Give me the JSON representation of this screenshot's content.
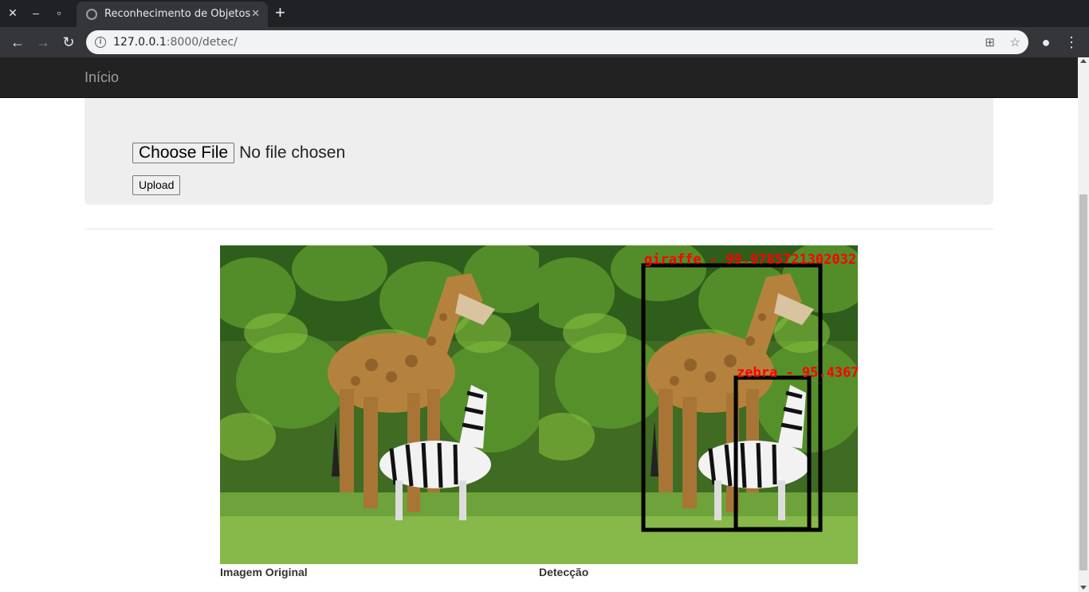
{
  "browser": {
    "tab_title": "Reconhecimento de Objetos",
    "url_host": "127.0.0.1",
    "url_rest": ":8000/detec/"
  },
  "navbar": {
    "brand": "Início"
  },
  "form": {
    "choose_label": "Choose File",
    "no_file_label": "No file chosen",
    "upload_label": "Upload"
  },
  "results": {
    "original_caption": "Imagem Original",
    "detection_caption": "Detecção",
    "detections": [
      {
        "label": "giraffe - 99.9785721302032"
      },
      {
        "label": "zebra - 95.4367"
      }
    ]
  },
  "colors": {
    "navbar_bg": "#222222",
    "detection_text": "#ff0000",
    "box_stroke": "#000000"
  }
}
